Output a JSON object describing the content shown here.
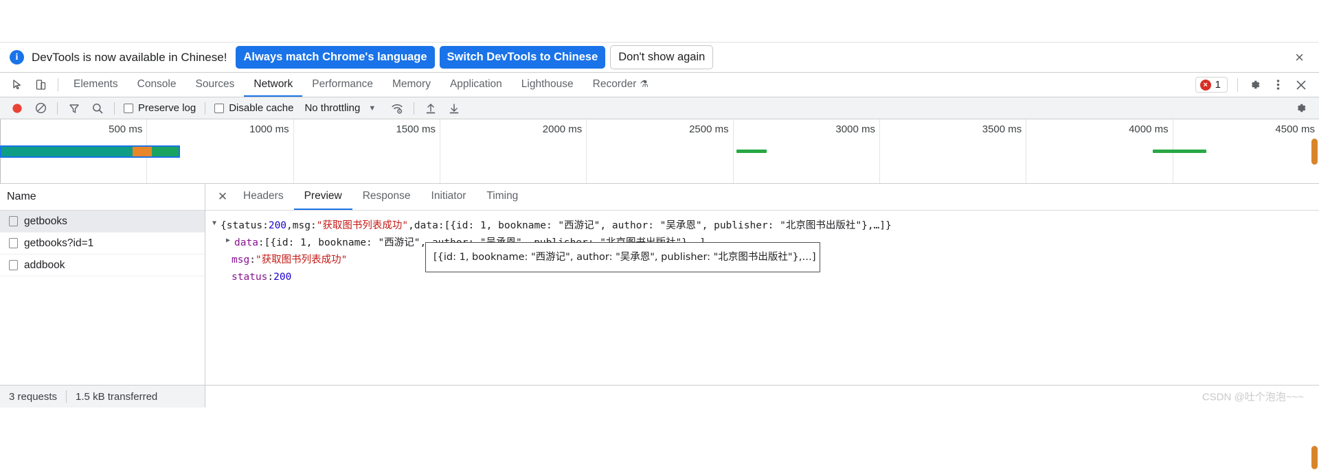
{
  "banner": {
    "icon": "info-icon",
    "message": "DevTools is now available in Chinese!",
    "primary_button": "Always match Chrome's language",
    "secondary_button": "Switch DevTools to Chinese",
    "dismiss_button": "Don't show again",
    "close_icon": "×"
  },
  "tabbar": {
    "icons": [
      "inspect-element-icon",
      "device-toolbar-icon"
    ],
    "tabs": [
      {
        "label": "Elements",
        "active": false
      },
      {
        "label": "Console",
        "active": false
      },
      {
        "label": "Sources",
        "active": false
      },
      {
        "label": "Network",
        "active": true
      },
      {
        "label": "Performance",
        "active": false
      },
      {
        "label": "Memory",
        "active": false
      },
      {
        "label": "Application",
        "active": false
      },
      {
        "label": "Lighthouse",
        "active": false
      },
      {
        "label": "Recorder",
        "active": false,
        "experimental": true
      }
    ],
    "error_count": "1",
    "error_glyph": "×",
    "right_icons": [
      "settings-gear-icon",
      "more-options-icon",
      "close-devtools-icon"
    ]
  },
  "network_toolbar": {
    "record_icon": "record-button",
    "clear_icon": "clear-icon",
    "filter_icon": "filter-icon",
    "search_icon": "search-icon",
    "preserve_log": {
      "label": "Preserve log",
      "checked": false
    },
    "disable_cache": {
      "label": "Disable cache",
      "checked": false
    },
    "throttling": {
      "value": "No throttling",
      "caret": "▼"
    },
    "wifi_icon": "network-conditions-icon",
    "import_icon": "import-har-icon",
    "export_icon": "export-har-icon",
    "settings_icon": "network-settings-gear-icon"
  },
  "overview": {
    "ticks": [
      "500 ms",
      "1000 ms",
      "1500 ms",
      "2000 ms",
      "2500 ms",
      "3000 ms",
      "3500 ms",
      "4000 ms",
      "4500 ms"
    ],
    "bars": [
      {
        "name": "getbooks",
        "left_pct": 0.0,
        "width_pct": 13.8,
        "type": "composite"
      },
      {
        "name": "getbooks-id-1",
        "left_pct": 56.7,
        "width_pct": 2.0,
        "type": "green"
      },
      {
        "name": "addbook",
        "left_pct": 87.5,
        "width_pct": 2.7,
        "type": "green"
      }
    ],
    "colors": {
      "border": "#1a73e8",
      "waiting": "#0f9d87",
      "stalled": "#e8862a",
      "download": "#1aa260",
      "green_bar": "#27a844"
    }
  },
  "request_list": {
    "header": "Name",
    "rows": [
      {
        "name": "getbooks",
        "selected": true
      },
      {
        "name": "getbooks?id=1",
        "selected": false
      },
      {
        "name": "addbook",
        "selected": false
      }
    ]
  },
  "detail_panel": {
    "close_icon": "✕",
    "tabs": [
      {
        "label": "Headers",
        "active": false
      },
      {
        "label": "Preview",
        "active": true
      },
      {
        "label": "Response",
        "active": false
      },
      {
        "label": "Initiator",
        "active": false
      },
      {
        "label": "Timing",
        "active": false
      }
    ],
    "preview": {
      "root": {
        "triangle": "▼",
        "open": "{",
        "status_key": "status: ",
        "status_val": "200",
        "comma1": ", ",
        "msg_key": "msg: ",
        "msg_val": "\"获取图书列表成功\"",
        "comma2": ", ",
        "data_key": "data: ",
        "data_val": "[{id: 1, bookname: \"西游记\", author: \"吴承恩\", publisher: \"北京图书出版社\"},…]}"
      },
      "data_row": {
        "triangle": "▶",
        "key": "data",
        "colon": ": ",
        "value": "[{id: 1, bookname: \"西游记\", author: \"吴承恩\", publisher: \"北京图书出版社\"},…]"
      },
      "msg_row": {
        "key": "msg",
        "colon": ": ",
        "value": "\"获取图书列表成功\""
      },
      "status_row": {
        "key": "status",
        "colon": ": ",
        "value": "200"
      },
      "tooltip": "[{id: 1, bookname: \"西游记\", author: \"吴承恩\", publisher: \"北京图书出版社\"},…]"
    }
  },
  "footer": {
    "requests": "3 requests",
    "transferred": "1.5 kB transferred",
    "watermark": "CSDN @吐个泡泡~~~"
  }
}
